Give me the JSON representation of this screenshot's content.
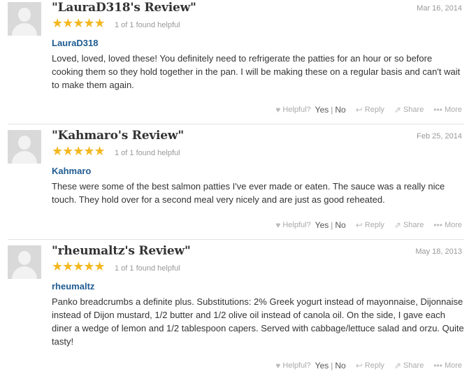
{
  "reviews": [
    {
      "title": "\"LauraD318's Review\"",
      "date": "Mar 16, 2014",
      "stars": "★★★★★",
      "helpful_count": "1 of 1 found helpful",
      "author": "LauraD318",
      "text": "Loved, loved, loved these! You definitely need to refrigerate the patties for an hour or so before cooking them so they hold together in the pan. I will be making these on a regular basis and can't wait to make them again."
    },
    {
      "title": "\"Kahmaro's Review\"",
      "date": "Feb 25, 2014",
      "stars": "★★★★★",
      "helpful_count": "1 of 1 found helpful",
      "author": "Kahmaro",
      "text": "These were some of the best salmon patties I've ever made or eaten. The sauce was a really nice touch. They hold over for a second meal very nicely and are just as good reheated."
    },
    {
      "title": "\"rheumaltz's Review\"",
      "date": "May 18, 2013",
      "stars": "★★★★★",
      "helpful_count": "1 of 1 found helpful",
      "author": "rheumaltz",
      "text": "Panko breadcrumbs a definite plus. Substitutions: 2% Greek yogurt instead of mayonnaise, Dijonnaise instead of Dijon mustard, 1/2 butter and 1/2 olive oil instead of canola oil. On the side, I gave each diner a wedge of lemon and 1/2 tablespoon capers. Served with cabbage/lettuce salad and orzu. Quite tasty!"
    }
  ],
  "actions": {
    "helpful_label": "Helpful?",
    "yes_label": "Yes",
    "separator": "|",
    "no_label": "No",
    "reply_label": "Reply",
    "share_label": "Share",
    "more_label": "More"
  },
  "icons": {
    "helpful": "heart-icon",
    "reply": "reply-arrow-icon",
    "share": "share-icon",
    "more": "ellipsis-icon",
    "avatar": "default-user-icon"
  },
  "colors": {
    "star": "#f3b820",
    "author_link": "#1f5b92",
    "muted": "#999999"
  }
}
